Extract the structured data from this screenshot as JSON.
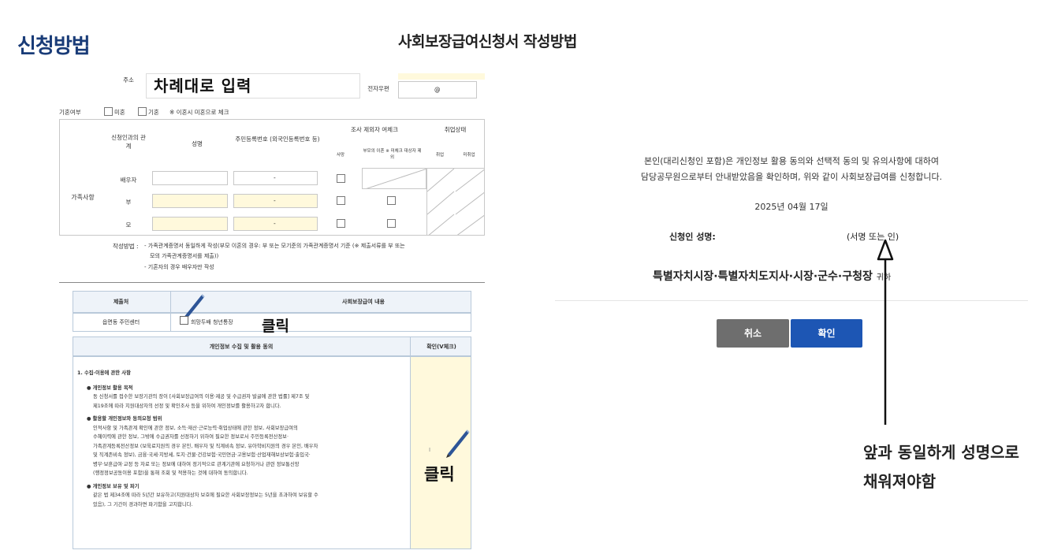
{
  "header": {
    "title": "신청방법",
    "subtitle": "사회보장급여신청서 작성방법"
  },
  "form_top": {
    "address_label": "주소",
    "instruction": "차례대로 입력",
    "email_label": "전자우편",
    "email_at": "@",
    "marital": {
      "label": "기혼여부",
      "opt1": "미혼",
      "opt2": "기혼",
      "note": "※ 이혼시 미혼으로 체크"
    },
    "family": {
      "section_label": "가족사항",
      "col_relation": "신청인과의 관계",
      "col_name": "성명",
      "col_id": "주민등록번호 (외국인등록번호 등)",
      "col_check": "조사 제외자 여체크",
      "col_check_sub1": "사망",
      "col_check_sub2": "부모의 이혼 ※ 미체크 대상자 제외",
      "col_job": "취업상태",
      "col_job_sub1": "취업",
      "col_job_sub2": "미취업",
      "rows": [
        {
          "relation": "배우자",
          "id_dash": "-"
        },
        {
          "relation": "부",
          "id_dash": "-"
        },
        {
          "relation": "모",
          "id_dash": "-"
        }
      ]
    },
    "notes_label": "작성방법 :",
    "note1": "- 가족관계증명서 동일하게 작성(부모 이혼의 경우: 부 또는 모기준의 가족관계증명서 기준 (※ 제출서류를 부 또는",
    "note1b": "모의 가족관계증명서를 제출))",
    "note2": "- 기혼자의 경우 배우자만 작성"
  },
  "form_bottom": {
    "office_label": "제출처",
    "content_label": "사회보장급여 내용",
    "office_value": "읍면동 주민센터",
    "content_value": "희망두배 청년통장",
    "click1": "클릭",
    "consent_title": "개인정보 수집 및 활용 동의",
    "confirm_title": "확인(V체크)",
    "section1": "1. 수집·이용에 관한 사항",
    "b1_title": "● 개인정보 활용 목적",
    "b1_l1": "동 신청서를 접수한 보장기관의 장이 [사회보장급여의 이용·제공 및 수급권자 발굴에 관한 법률] 제7조 및",
    "b1_l2": "제19조에 따라 지원대상자의 선정 및 확인조사 등을 위하여 개인정보를 활용하고자 합니다.",
    "b2_title": "● 활용할 개인정보와 동의요청 범위",
    "b2_l1": "인적사항 및 가족관계 확인에 관한 정보, 소득·재산·근로능력·취업상태에 관한 정보, 사회보장급여의",
    "b2_l2": "수혜이력에 관한 정보, 그밖에 수급권자를 선정하기 위하여 필요한 정보로서 주민등록전산정보·",
    "b2_l3": "가족관계등록전산정보 (보육료지원의 경우 본인, 배우자 및 직계비속 정보, 유아학비지원의 경우 본인, 배우자",
    "b2_l4": "및 직계존비속 정보), 금융·국세·지방세, 토지·건물·건강보험·국민연금·고용보험·산업재해보상보험·출입국·",
    "b2_l5": "병무·보훈급여·교정 등 자료 또는 정보에 대하여 정기적으로 관계기관에 요청하거나 관련 정보통신망",
    "b2_l6": "(행정정보공동이용 포함)을 통해 조회 및 적용하는 것에 대하여 동의합니다.",
    "b3_title": "● 개인정보 보유 및 파기",
    "b3_l1": "같은 법 제34조에 따라 5년간 보유하고(지원대상자 보호에 필요한 사회보장정보는 5년을 초과하여 보유할 수",
    "b3_l2": "있음), 그 기간이 경과하면 파기함을 고지합니다.",
    "click2": "클릭",
    "confirm_mark": "I"
  },
  "dialog": {
    "line1": "본인(대리신청인 포함)은 개인정보 활용 동의와 선택적 동의 및 유의사항에 대하여",
    "line2": "담당공무원으로부터 안내받았음을 확인하며, 위와 같이 사회보장급여를 신청합니다.",
    "date": "2025년 04월 17일",
    "applicant_label": "신청인 성명:",
    "signature": "(서명 또는 인)",
    "addressee": "특별자치시장·특별자치도지사·시장·군수·구청장",
    "addressee_suffix": "귀하",
    "cancel": "취소",
    "confirm": "확인"
  },
  "annotation": {
    "line1": "앞과 동일하게 성명으로",
    "line2": "채워져야함"
  },
  "colors": {
    "title_blue": "#1a3c78",
    "btn_gray": "#6e6e6e",
    "btn_blue": "#1d56b4",
    "highlight_yellow": "#fff9dc"
  }
}
